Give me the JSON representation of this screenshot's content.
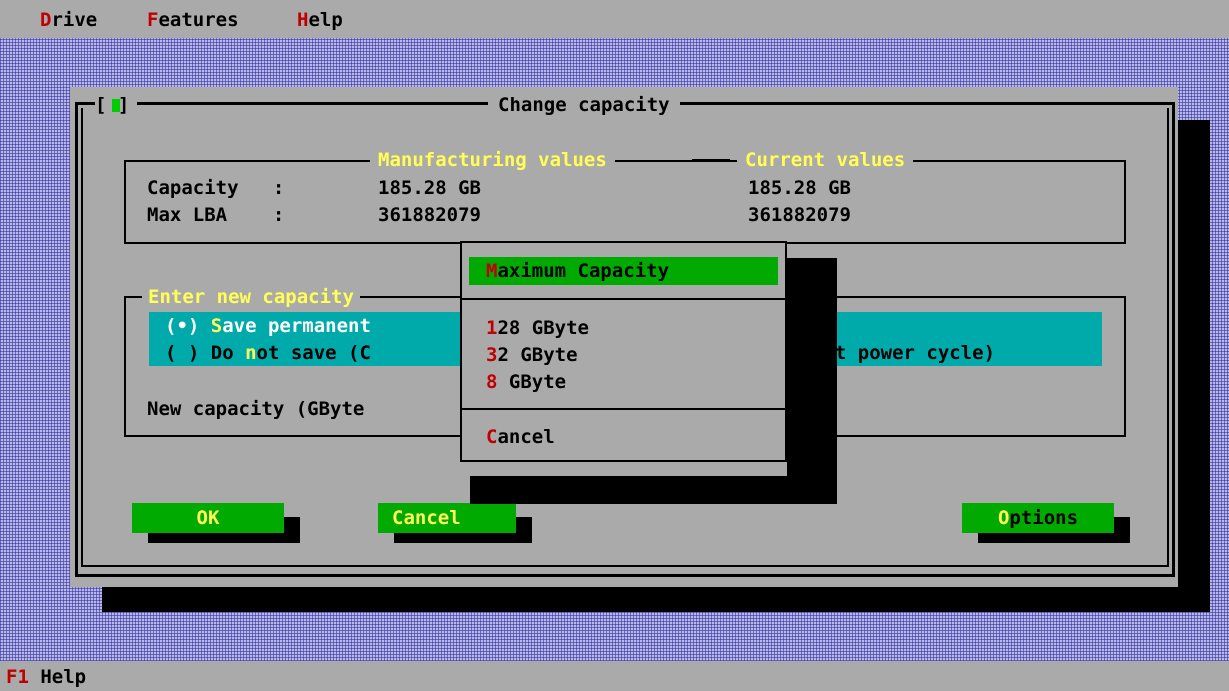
{
  "menubar": {
    "items": [
      {
        "hotkey": "D",
        "rest": "rive"
      },
      {
        "hotkey": "F",
        "rest": "eatures"
      },
      {
        "hotkey": "H",
        "rest": "elp"
      }
    ]
  },
  "dialog": {
    "title": "Change capacity",
    "close_control": "[■]",
    "info": {
      "header_manufacturing": "Manufacturing values",
      "header_current": "Current values",
      "rows": [
        {
          "label": "Capacity   :",
          "manufacturing": "185.28 GB",
          "current": "185.28 GB"
        },
        {
          "label": "Max LBA    :",
          "manufacturing": "361882079",
          "current": "361882079"
        }
      ]
    },
    "new_capacity": {
      "legend": "Enter new capacity",
      "option_save_prefix": "(•) ",
      "option_save_hotkey": "S",
      "option_save_rest": "ave permanent",
      "option_nosave_prefix": "( ) Do ",
      "option_nosave_hotkey": "n",
      "option_nosave_rest": "ot save (C",
      "option_nosave_tail": "ext power cycle)",
      "field_label": "New capacity (GByte"
    },
    "buttons": {
      "ok": "OK",
      "cancel": "Cancel",
      "options_hotkey": "O",
      "options_rest": "ptions"
    }
  },
  "popup": {
    "items": [
      {
        "hotkey": "M",
        "rest": "aximum Capacity",
        "selected": true
      },
      {
        "hotkey": "1",
        "rest": "28 GByte"
      },
      {
        "hotkey": "3",
        "rest": "2 GByte"
      },
      {
        "hotkey": "8",
        "rest": " GByte"
      },
      {
        "hotkey": "C",
        "rest": "ancel"
      }
    ]
  },
  "statusbar": {
    "key": "F1",
    "label": " Help"
  },
  "colors": {
    "background_gray": "#aaaaaa",
    "hotkey_red": "#c00000",
    "title_yellow": "#ffff55",
    "teal": "#00aaaa",
    "green": "#00aa00",
    "desktop_blue": "#2828aa"
  }
}
